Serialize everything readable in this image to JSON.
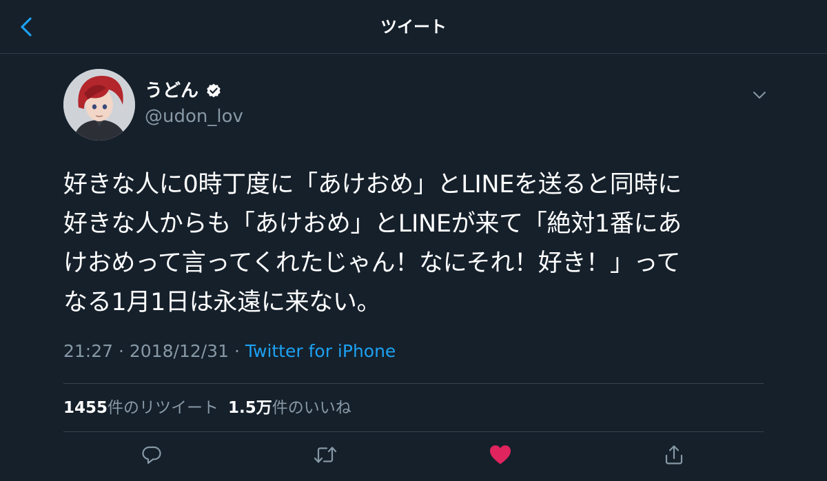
{
  "header": {
    "title": "ツイート",
    "back_icon": "chevron-left-icon"
  },
  "tweet": {
    "author": {
      "name": "うどん",
      "handle": "@udon_lov",
      "verified": true
    },
    "text_lines": [
      "好きな人に0時丁度に「あけおめ」とLINEを送ると同時に",
      "好きな人からも「あけおめ」とLINEが来て「絶対1番にあ",
      "けおめって言ってくれたじゃん！なにそれ！好き！」って",
      "なる1月1日は永遠に来ない。"
    ],
    "time": "21:27",
    "separator": "·",
    "date": "2018/12/31",
    "source": "Twitter for iPhone"
  },
  "stats": {
    "retweet_count": "1455",
    "retweet_label": "件のリツイート",
    "like_count": "1.5万",
    "like_label": "件のいいね"
  },
  "actions": {
    "reply_icon": "reply-icon",
    "retweet_icon": "retweet-icon",
    "like_icon": "heart-icon",
    "share_icon": "share-icon"
  },
  "colors": {
    "background": "#15202b",
    "accent": "#1da1f2",
    "secondary_text": "#8899a6",
    "like": "#e0245e"
  }
}
